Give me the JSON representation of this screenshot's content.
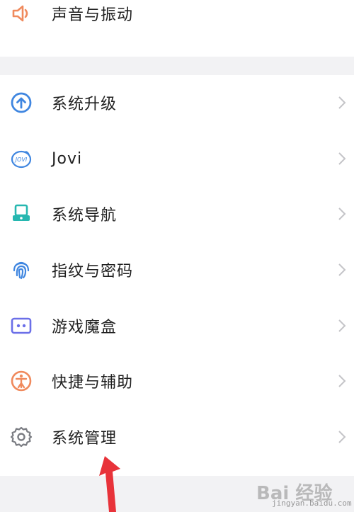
{
  "settings": {
    "top_item": {
      "label": "声音与振动",
      "icon": "speaker-icon",
      "color": "#f08a5d"
    },
    "items": [
      {
        "label": "系统升级",
        "icon": "upload-circle-icon",
        "color": "#3f86e0"
      },
      {
        "label": "Jovi",
        "icon": "jovi-icon",
        "color": "#3f86e0"
      },
      {
        "label": "系统导航",
        "icon": "navigation-icon",
        "color": "#26b7b0"
      },
      {
        "label": "指纹与密码",
        "icon": "fingerprint-icon",
        "color": "#3f86e0"
      },
      {
        "label": "游戏魔盒",
        "icon": "gamepad-icon",
        "color": "#6b6fe8"
      },
      {
        "label": "快捷与辅助",
        "icon": "accessibility-icon",
        "color": "#f08a5d"
      },
      {
        "label": "系统管理",
        "icon": "gear-icon",
        "color": "#7b7d83"
      }
    ]
  },
  "overlay": {
    "arrow_color": "#e8333a",
    "watermark_top": "Bai 经验",
    "watermark_bottom": "jingyan.baidu.com"
  }
}
